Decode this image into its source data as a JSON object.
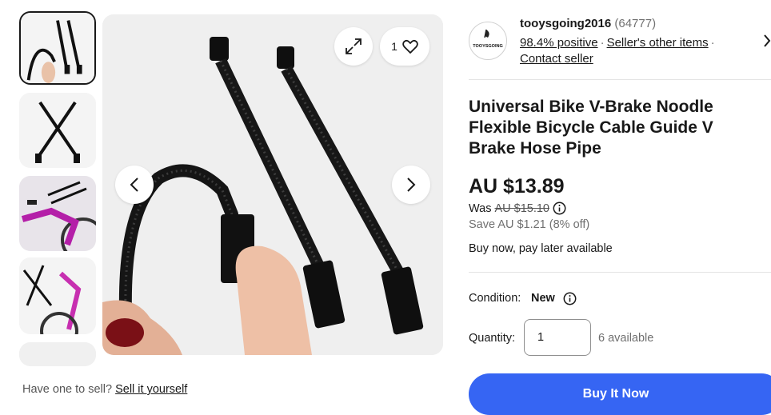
{
  "gallery": {
    "image_count": "1",
    "expand_icon": "expand-icon",
    "heart_icon": "heart-icon",
    "prev_icon": "chevron-left-icon",
    "next_icon": "chevron-right-icon",
    "thumbnails": [
      "thumb-1",
      "thumb-2",
      "thumb-3",
      "thumb-4",
      "thumb-5"
    ],
    "sell_prompt": "Have one to sell?",
    "sell_link": "Sell it yourself"
  },
  "seller": {
    "logo_text": "TOOYSGOING",
    "name": "tooysgoing2016",
    "feedback_count": "(64777)",
    "positive": "98.4% positive",
    "other_items": "Seller's other items",
    "contact": "Contact seller"
  },
  "product": {
    "title": "Universal Bike V-Brake Noodle Flexible Bicycle Cable Guide V Brake Hose Pipe",
    "price": "AU $13.89",
    "was_label": "Was",
    "was_price": "AU $15.10",
    "save": "Save AU $1.21 (8% off)",
    "buy_now_note": "Buy now, pay later available",
    "condition_label": "Condition:",
    "condition_value": "New",
    "quantity_label": "Quantity:",
    "quantity_value": "1",
    "available": "6 available",
    "buy_button": "Buy It Now"
  },
  "colors": {
    "accent": "#3665f3",
    "text": "#191919",
    "muted": "#707070"
  }
}
